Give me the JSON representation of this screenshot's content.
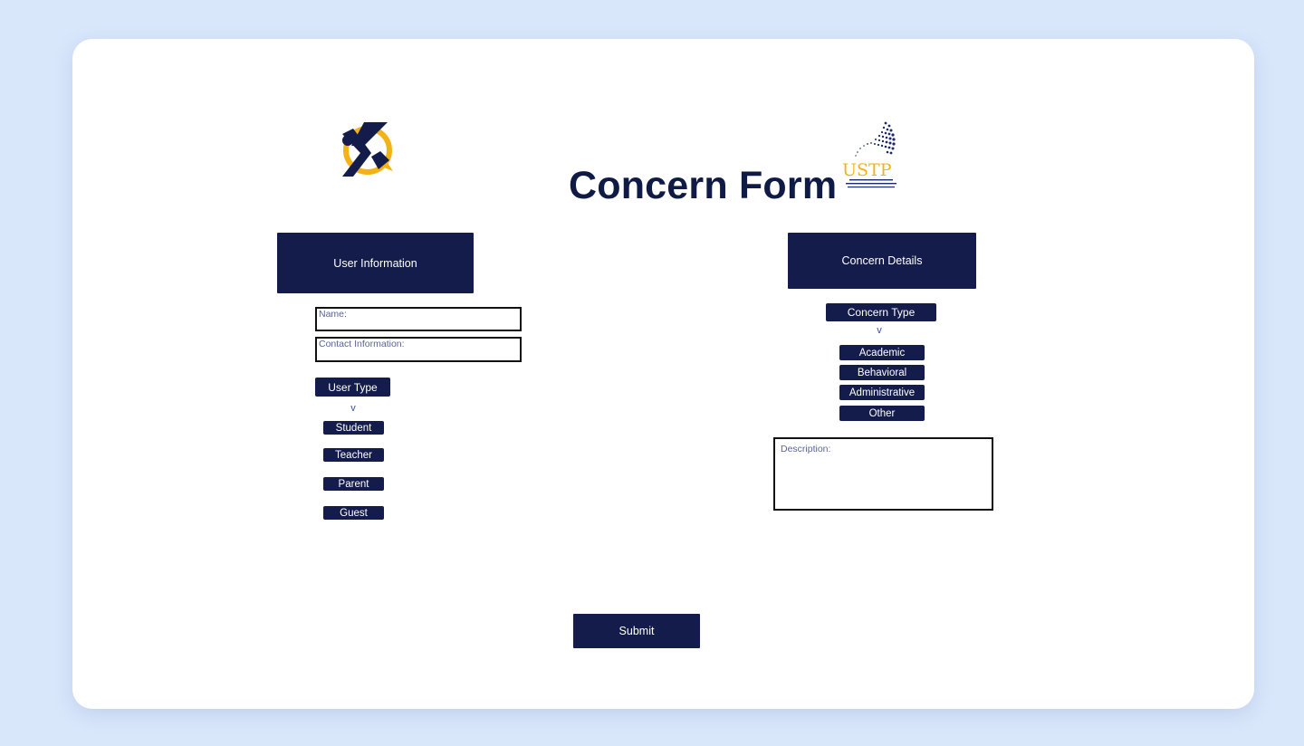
{
  "header": {
    "title": "Concern Form",
    "ustp_logo_text": "USTP"
  },
  "user_info": {
    "header_label": "User Information",
    "name_label": "Name:",
    "contact_label": "Contact Information:",
    "user_type_label": "User Type",
    "chevron": "v",
    "options": [
      "Student",
      "Teacher",
      "Parent",
      "Guest"
    ]
  },
  "concern": {
    "header_label": "Concern Details",
    "type_label": "Concern Type",
    "chevron": "v",
    "options": [
      "Academic",
      "Behavioral",
      "Administrative",
      "Other"
    ],
    "description_label": "Description:"
  },
  "actions": {
    "submit_label": "Submit"
  },
  "colors": {
    "primary_navy": "#131c4b",
    "logo_gold": "#f3b316",
    "background": "#d9e7fb"
  }
}
